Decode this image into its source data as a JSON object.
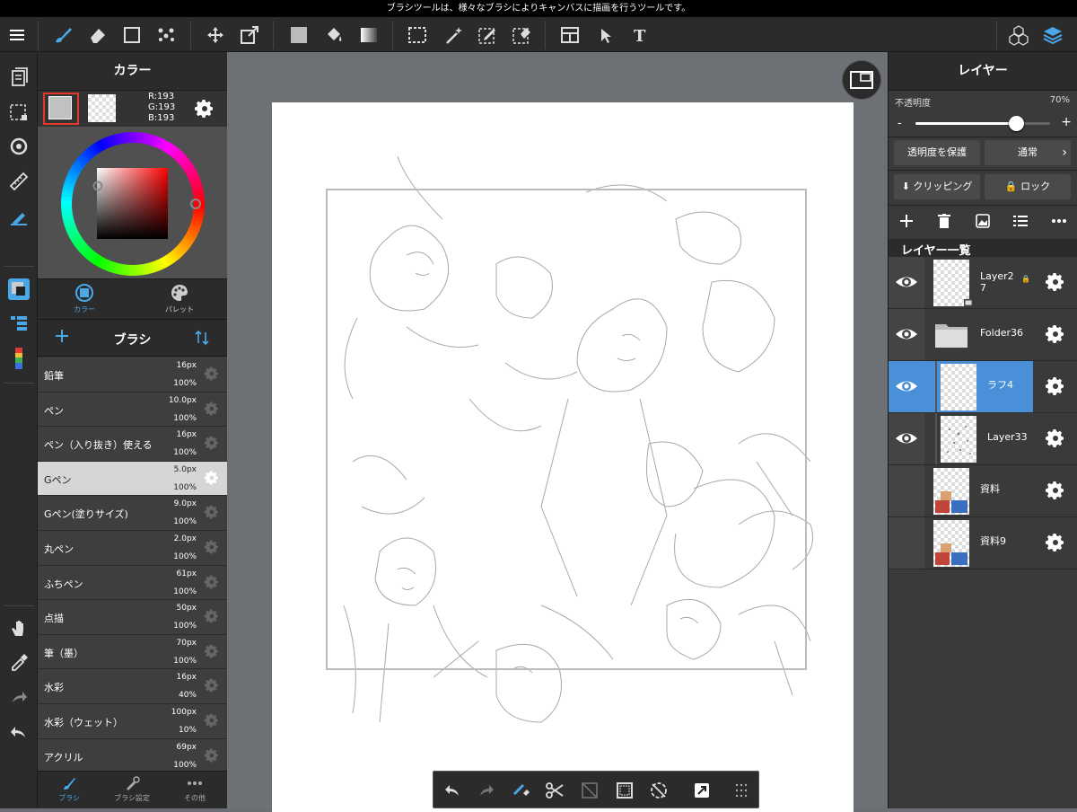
{
  "status_text": "ブラシツールは、様々なブラシによりキャンバスに描画を行うツールです。",
  "color_panel": {
    "title": "カラー",
    "rgb": {
      "r": "R:193",
      "g": "G:193",
      "b": "B:193"
    },
    "tabs": [
      "カラー",
      "パレット"
    ]
  },
  "brush_panel": {
    "title": "ブラシ",
    "brushes": [
      {
        "name": "鉛筆",
        "size": "16px",
        "opacity": "100%"
      },
      {
        "name": "ペン",
        "size": "10.0px",
        "opacity": "100%"
      },
      {
        "name": "ペン（入り抜き）使える",
        "size": "16px",
        "opacity": "100%"
      },
      {
        "name": "Gペン",
        "size": "5.0px",
        "opacity": "100%"
      },
      {
        "name": "Gペン(塗りサイズ)",
        "size": "9.0px",
        "opacity": "100%"
      },
      {
        "name": "丸ペン",
        "size": "2.0px",
        "opacity": "100%"
      },
      {
        "name": "ふちペン",
        "size": "61px",
        "opacity": "100%"
      },
      {
        "name": "点描",
        "size": "50px",
        "opacity": "100%"
      },
      {
        "name": "筆（墨）",
        "size": "70px",
        "opacity": "100%"
      },
      {
        "name": "水彩",
        "size": "16px",
        "opacity": "40%"
      },
      {
        "name": "水彩（ウェット）",
        "size": "100px",
        "opacity": "10%"
      },
      {
        "name": "アクリル",
        "size": "69px",
        "opacity": "100%"
      }
    ],
    "selected_index": 3,
    "bottom_tabs": [
      "ブラシ",
      "ブラシ設定",
      "その他"
    ]
  },
  "layer_panel": {
    "title": "レイヤー",
    "opacity_label": "不透明度",
    "opacity_value": "70%",
    "opacity_fraction": 0.7,
    "protect_label": "透明度を保護",
    "blend_mode": "通常",
    "clipping_label": "クリッピング",
    "lock_label": "ロック",
    "list_title": "レイヤー一覧",
    "layers": [
      {
        "name": "Layer2\n7"
      },
      {
        "name": "Folder36"
      },
      {
        "name": "ラフ4"
      },
      {
        "name": "Layer33"
      },
      {
        "name": "資料"
      },
      {
        "name": "資料9"
      }
    ]
  },
  "colors": {
    "accent": "#4a90d9",
    "selected_swatch_border": "#e23a2a",
    "foreground": "#c1c1c1"
  }
}
